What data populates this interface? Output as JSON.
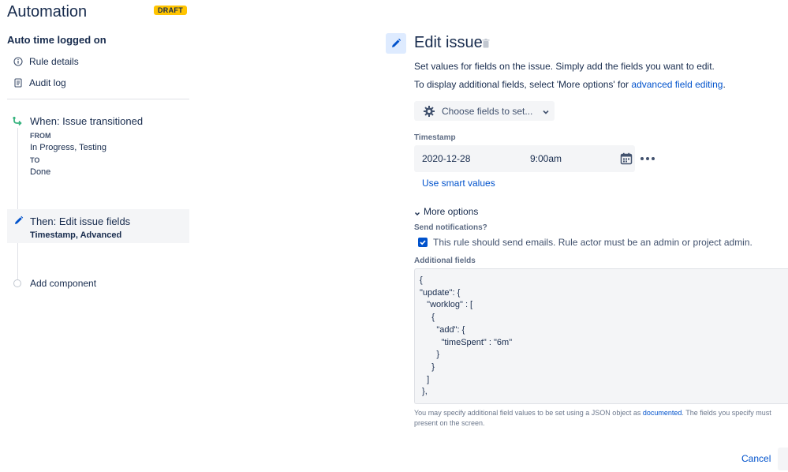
{
  "app": {
    "title": "Automation",
    "badge": "DRAFT",
    "badge_color": "#ffc400",
    "accent_color": "#0052cc"
  },
  "rule": {
    "name": "Auto time logged on"
  },
  "nav": {
    "rule_details": {
      "label": "Rule details",
      "icon": "info-icon"
    },
    "audit_log": {
      "label": "Audit log",
      "icon": "document-icon"
    }
  },
  "trigger": {
    "title": "When: Issue transitioned",
    "icon": "branch-icon",
    "from_label": "FROM",
    "from_value": "In Progress, Testing",
    "to_label": "TO",
    "to_value": "Done"
  },
  "action": {
    "title": "Then: Edit issue fields",
    "icon": "pencil-icon",
    "fields_bold_1": "Timestamp",
    "separator": ", ",
    "fields_bold_2": "Advanced"
  },
  "add_component": {
    "label": "Add component"
  },
  "panel": {
    "title": "Edit issue",
    "description_1": "Set values for fields on the issue. Simply add the fields you want to edit.",
    "description_2_prefix": "To display additional fields, select 'More options' for ",
    "description_2_link": "advanced field editing",
    "description_2_suffix": ".",
    "choose_fields_label": "Choose fields to set...",
    "timestamp": {
      "label": "Timestamp",
      "date": "2020-12-28",
      "time": "9:00am"
    },
    "smart_values_link": "Use smart values",
    "more_options_label": "More options",
    "send_notifications": {
      "label": "Send notifications?",
      "checked": true,
      "text": "This rule should send emails. Rule actor must be an admin or project admin."
    },
    "additional_fields": {
      "label": "Additional fields",
      "lines": [
        "{",
        "\"update\": {",
        "   \"worklog\" : [",
        "     {",
        "       \"add\": {",
        "         \"timeSpent\" : \"6m\"",
        "       }",
        "     }",
        "   ]",
        " },"
      ]
    },
    "help_prefix": "You may specify additional field values to be set using a JSON object as ",
    "help_link": "documented",
    "help_suffix": ". The fields you specify must",
    "help_line2": "present on the screen.",
    "cancel_label": "Cancel"
  }
}
